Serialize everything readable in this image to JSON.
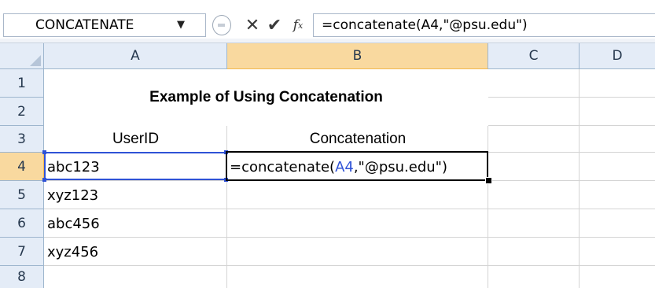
{
  "formula_bar": {
    "name_box": "CONCATENATE",
    "name_box_arrow": "▼",
    "cancel_glyph": "✕",
    "enter_glyph": "✔",
    "fx_label": "f",
    "fx_sub": "x",
    "formula": "=concatenate(A4,\"@psu.edu\")"
  },
  "columns": [
    "A",
    "B",
    "C",
    "D"
  ],
  "rows": [
    "1",
    "2",
    "3",
    "4",
    "5",
    "6",
    "7",
    "8"
  ],
  "sheet": {
    "title": "Example of Using Concatenation",
    "header_userid": "UserID",
    "header_concat": "Concatenation",
    "userids": [
      "abc123",
      "xyz123",
      "abc456",
      "xyz456"
    ],
    "edit_formula": {
      "prefix": "=concatenate(",
      "ref": "A4",
      "suffix": ",\"@psu.edu\")"
    }
  },
  "active_cell": "B4",
  "referenced_cell": "A4",
  "colors": {
    "header_bg": "#e4ecf7",
    "selected_header_bg": "#f9d99f",
    "reference_blue": "#2f52d6"
  }
}
